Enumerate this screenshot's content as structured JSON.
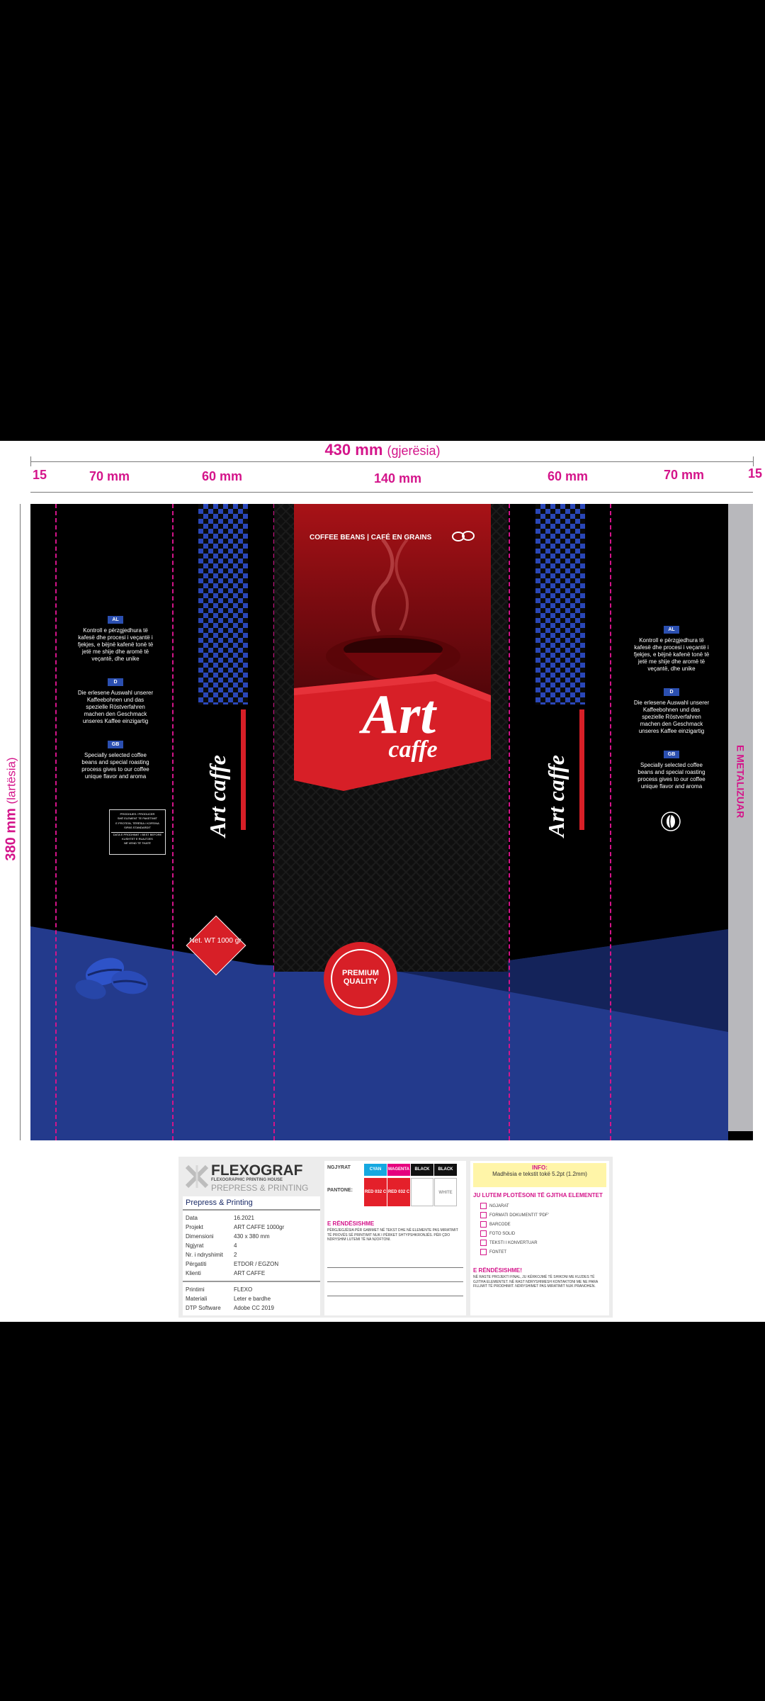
{
  "dimensions": {
    "width_total": "430 mm",
    "width_total_suffix": "(gjerësia)",
    "height_total": "380 mm",
    "height_suffix": "(lartësia)",
    "segments": [
      "15",
      "70 mm",
      "60 mm",
      "140 mm",
      "60 mm",
      "70 mm",
      "15"
    ]
  },
  "bag": {
    "tagline": "COFFEE BEANS | CAFÉ EN GRAINS",
    "brand_top": "Art",
    "brand_bottom": "caffe",
    "side_brand": "Art caffe",
    "net_weight": "Net. WT 1000 gr",
    "seal_text": "PREMIUM QUALITY",
    "metallized_label": "E METALIZUAR",
    "lang_al": "AL",
    "lang_de": "D",
    "lang_gb": "GB",
    "text_al": "Kontroll e përzgjedhura të kafesë dhe procesi i veçantë i fjekjes, e bëjnë kafenë tonë të jetë me shije dhe aromë të veçantë, dhe unike",
    "text_de": "Die erlesene Auswahl unserer Kaffeebohnen und das spezielle Röstverfahren machen den Geschmack unseres Kaffee einzigartig",
    "text_gb": "Specially selected coffee beans and special roasting process gives to our coffee unique flavor and aroma",
    "label_lines": [
      "PRODHUES / PRODUCER",
      "SHË ELEMENT TE PAKETIMIT",
      "E PROTEIN, TËRËSIA / KOFEINA",
      "SIPAS STANDARDIT",
      "DATA E PRODHIMIT / BEST BEFORE",
      "KUSHTET E RUAJTJES",
      "NË VEND TË THATË"
    ]
  },
  "footer": {
    "company": "FLEXOGRAF",
    "company_sub": "FLEXOGRAPHIC PRINTING HOUSE",
    "company_tag": "PREPRESS & PRINTING",
    "section_title": "Prepress & Printing",
    "rows": [
      {
        "label": "Data",
        "value": "16.2021"
      },
      {
        "label": "Projekt",
        "value": "ART CAFFE 1000gr"
      },
      {
        "label": "Dimensioni",
        "value": "430 x 380 mm"
      },
      {
        "label": "Ngjyrat",
        "value": "4"
      },
      {
        "label": "Nr. i ndryshimit",
        "value": "2"
      },
      {
        "label": "Përgatiti",
        "value": "ETDOR / EGZON"
      },
      {
        "label": "Klienti",
        "value": "ART CAFFE"
      }
    ],
    "rows2": [
      {
        "label": "Printimi",
        "value": "FLEXO"
      },
      {
        "label": "Materiali",
        "value": "Leter e bardhe"
      },
      {
        "label": "DTP Software",
        "value": "Adobe CC 2019"
      }
    ],
    "colors_label": "NGJYRAT",
    "pantone_label": "PANTONE:",
    "swatches": [
      {
        "name": "CYAN",
        "color": "#15a8e0"
      },
      {
        "name": "MAGENTA",
        "color": "#e5007e"
      },
      {
        "name": "BLACK",
        "color": "#111111"
      },
      {
        "name": "BLACK",
        "color": "#111111"
      }
    ],
    "pantones": [
      {
        "name": "RED 032 C",
        "color": "#e4202a"
      },
      {
        "name": "RED 032 C",
        "color": "#e4202a"
      },
      {
        "name": "",
        "color": "#ffffff"
      },
      {
        "name": "WHITE",
        "color": "#ffffff"
      }
    ],
    "important_title": "E RËNDËSISHME",
    "important_text": "PËRGJEGJËSIA PËR GABIMET NË TEKST DHE NË ELEMENTE PAS MIRATIMIT TË PROVËS SË PRINTIMIT NUK I PËRKET SHTYPSHKRONJËS. PËR ÇDO NDRYSHIM LUTEMI TË NA NJOFTONI.",
    "info_title": "INFO:",
    "info_text": "Madhësia e tekstit tokë 5.2pt (1.2mm)",
    "request_title": "JU LUTEM PLOTËSONI TË GJITHA ELEMENTET",
    "checks": [
      "NGJARAT",
      "FORMATI DOKUMENTIT 'PDF'",
      "BARCODE",
      "FOTO SOLID",
      "TEKSTI I KONVERTUAR",
      "FONTET"
    ],
    "important2_title": "E RËNDËSISHME!",
    "important2_text": "NË RASTE PROJEKTI FINAL, JU KËRKOJMË TË SHIKONI ME KUJDES TË GJITHA ELEMENTET. NË RAST NDRYSHIMESH KONTAKTONI ME NE PARA FILLIMIT TË PRODHIMIT. NDRYSHIMET PAS MIRATIMIT NUK PRANOHEN."
  }
}
